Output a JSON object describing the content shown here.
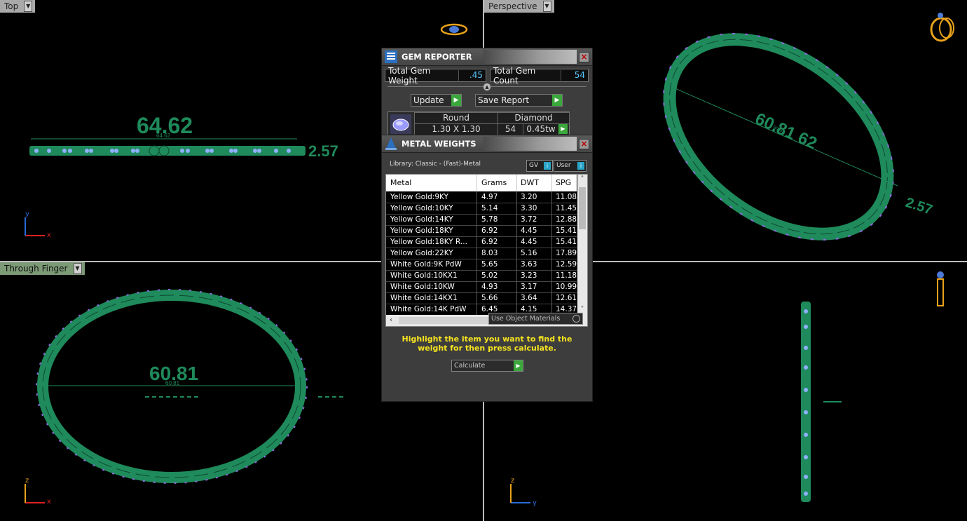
{
  "viewports": {
    "top": {
      "label": "Top",
      "dim_large": "64.62",
      "dim_small": "64.62",
      "dim_side": "2.57",
      "axis_y": "y",
      "axis_x": "x"
    },
    "perspective": {
      "label": "Perspective",
      "dim_large": "60.81 62",
      "dim_small": "60.81",
      "dim_side": "2.57"
    },
    "through_finger": {
      "label": "Through Finger",
      "dim_large": "60.81",
      "dim_small": "60.81",
      "axis_z": "z",
      "axis_x": "x"
    },
    "side": {
      "axis_z": "z",
      "axis_y": "y"
    }
  },
  "gem_reporter": {
    "title": "GEM REPORTER",
    "total_gem_weight_label": "Total Gem Weight",
    "total_gem_weight": ".45",
    "total_gem_count_label": "Total Gem Count",
    "total_gem_count": "54",
    "update_label": "Update",
    "save_report_label": "Save Report",
    "gem": {
      "shape": "Round",
      "material": "Diamond",
      "size": "1.30 X 1.30",
      "count": "54",
      "weight": "0.45tw"
    }
  },
  "metal_weights": {
    "title": "METAL WEIGHTS",
    "library": "Library: Classic - (Fast)-Metal",
    "gv_label": "GV",
    "user_label": "User",
    "columns": [
      "Metal",
      "Grams",
      "DWT",
      "SPG"
    ],
    "rows": [
      [
        "Yellow Gold:9KY",
        "4.97",
        "3.20",
        "11.08"
      ],
      [
        "Yellow Gold:10KY",
        "5.14",
        "3.30",
        "11.45"
      ],
      [
        "Yellow Gold:14KY",
        "5.78",
        "3.72",
        "12.88"
      ],
      [
        "Yellow Gold:18KY",
        "6.92",
        "4.45",
        "15.41"
      ],
      [
        "Yellow Gold:18KY R...",
        "6.92",
        "4.45",
        "15.41"
      ],
      [
        "Yellow Gold:22KY",
        "8.03",
        "5.16",
        "17.89"
      ],
      [
        "White Gold:9K PdW",
        "5.65",
        "3.63",
        "12.59"
      ],
      [
        "White Gold:10KX1",
        "5.02",
        "3.23",
        "11.18"
      ],
      [
        "White Gold:10KW",
        "4.93",
        "3.17",
        "10.99"
      ],
      [
        "White Gold:14KX1",
        "5.66",
        "3.64",
        "12.61"
      ],
      [
        "White Gold:14K PdW",
        "6.45",
        "4.15",
        "14.37"
      ]
    ],
    "use_object_materials_label": "Use Object Materials",
    "message": "Highlight the item you want to find the weight for then press calculate.",
    "calculate_label": "Calculate"
  },
  "colors": {
    "model_green": "#1f8a5b",
    "gem_purple": "#8a6bdc",
    "highlight_yellow": "#f7e51e",
    "accent_cyan": "#58c8ff"
  }
}
